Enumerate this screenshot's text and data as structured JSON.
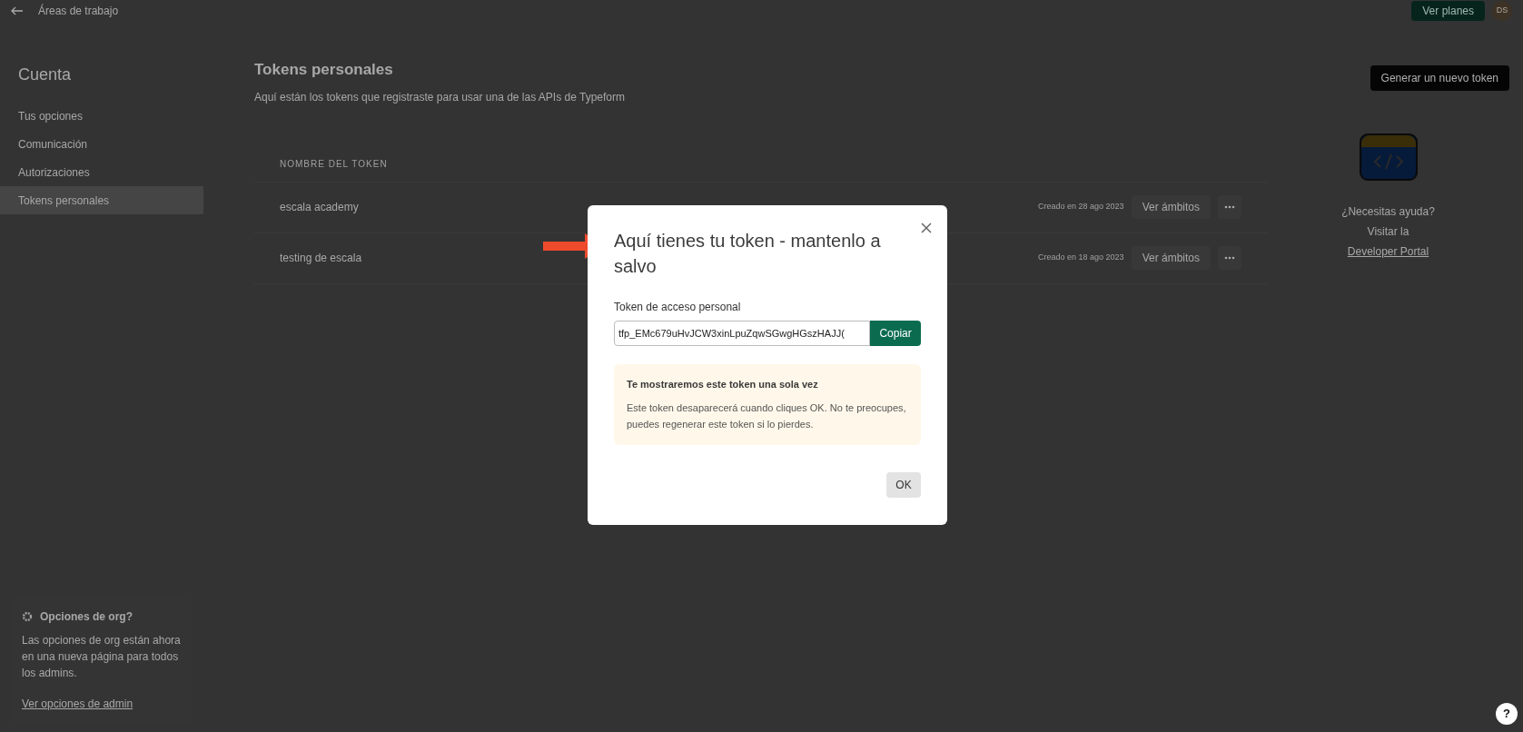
{
  "topbar": {
    "back_label": "Áreas de trabajo",
    "plans_button": "Ver planes",
    "avatar": "DS"
  },
  "sidebar": {
    "title": "Cuenta",
    "items": [
      {
        "label": "Tus opciones",
        "selected": false
      },
      {
        "label": "Comunicación",
        "selected": false
      },
      {
        "label": "Autorizaciones",
        "selected": false
      },
      {
        "label": "Tokens personales",
        "selected": true
      }
    ]
  },
  "org_notice": {
    "title": "Opciones de org?",
    "text": "Las opciones de org están ahora en una nueva página para todos los admins.",
    "link": "Ver opciones de admin"
  },
  "main": {
    "title": "Tokens personales",
    "subtitle": "Aquí están los tokens que registraste para usar una de las APIs de Typeform",
    "new_token_button": "Generar un nuevo token",
    "table": {
      "columns": [
        "NOMBRE DEL TOKEN"
      ],
      "rows": [
        {
          "name": "escala academy",
          "created": "Creado en 28 ago 2023",
          "scopes_button": "Ver ámbitos"
        },
        {
          "name": "testing de escala",
          "created": "Creado en 18 ago 2023",
          "scopes_button": "Ver ámbitos"
        }
      ]
    }
  },
  "help": {
    "question": "¿Necesitas ayuda?",
    "visit": "Visitar la",
    "link": "Developer Portal"
  },
  "modal": {
    "title": "Aquí tienes tu token - mantenlo a salvo",
    "field_label": "Token de acceso personal",
    "field_value": "tfp_EMc679uHvJCW3xinLpuZqwSGwgHGszHAJJ(",
    "copy_button": "Copiar",
    "notice_title": "Te mostraremos este token una sola vez",
    "notice_text": "Este token desaparecerá cuando cliques OK. No te preocupes, puedes regenerar este token si lo pierdes.",
    "ok_button": "OK"
  },
  "help_button": "?"
}
